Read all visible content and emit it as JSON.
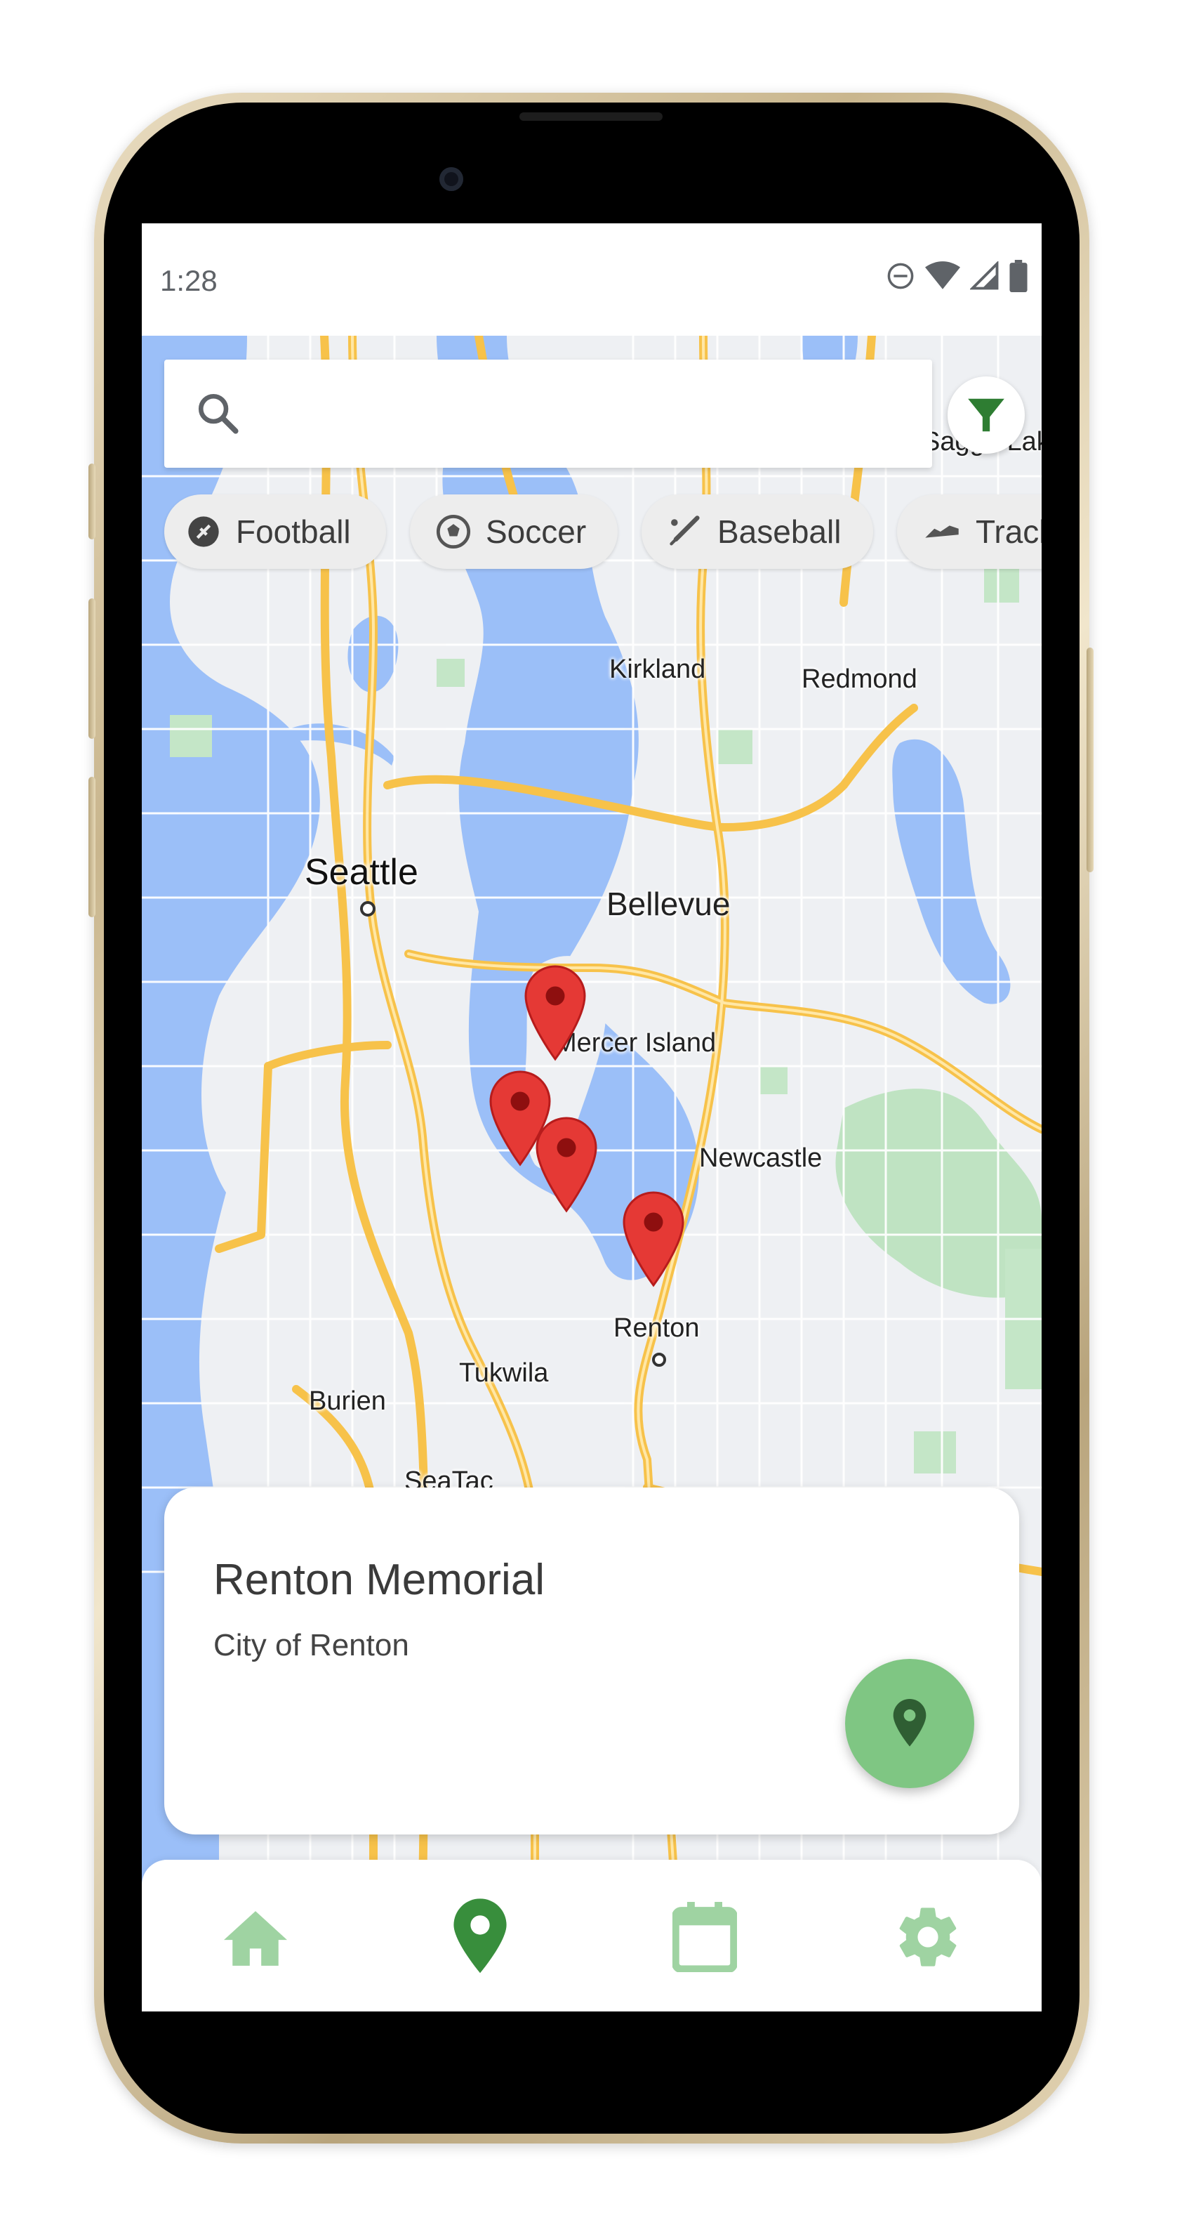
{
  "status_bar": {
    "time": "1:28"
  },
  "search": {
    "placeholder": "",
    "value": ""
  },
  "filter": {
    "icon": "filter-icon",
    "color": "#2e7d32"
  },
  "chips": [
    {
      "label": "Football",
      "icon": "football-icon"
    },
    {
      "label": "Soccer",
      "icon": "soccer-ball-icon"
    },
    {
      "label": "Baseball",
      "icon": "baseball-bat-icon"
    },
    {
      "label": "Track",
      "icon": "running-shoe-icon"
    }
  ],
  "map": {
    "labels": {
      "seattle": "Seattle",
      "bellevue": "Bellevue",
      "kirkland": "Kirkland",
      "redmond": "Redmond",
      "mercer_island": "Mercer Island",
      "newcastle": "Newcastle",
      "renton": "Renton",
      "tukwila": "Tukwila",
      "burien": "Burien",
      "seatac": "SeaTac",
      "top_right": "Sagge Lake"
    },
    "marker_count": 4,
    "marker_color": "#e53935"
  },
  "selected_location": {
    "name": "Renton Memorial",
    "owner": "City of Renton"
  },
  "fab": {
    "icon": "location-pin-icon",
    "color": "#7fc683"
  },
  "bottom_nav": {
    "active": "map",
    "active_color": "#388e3c",
    "inactive_color": "#9fd3a2",
    "items": [
      {
        "name": "home",
        "icon": "home-icon"
      },
      {
        "name": "map",
        "icon": "location-pin-icon"
      },
      {
        "name": "calendar",
        "icon": "calendar-icon"
      },
      {
        "name": "settings",
        "icon": "gear-icon"
      }
    ]
  }
}
